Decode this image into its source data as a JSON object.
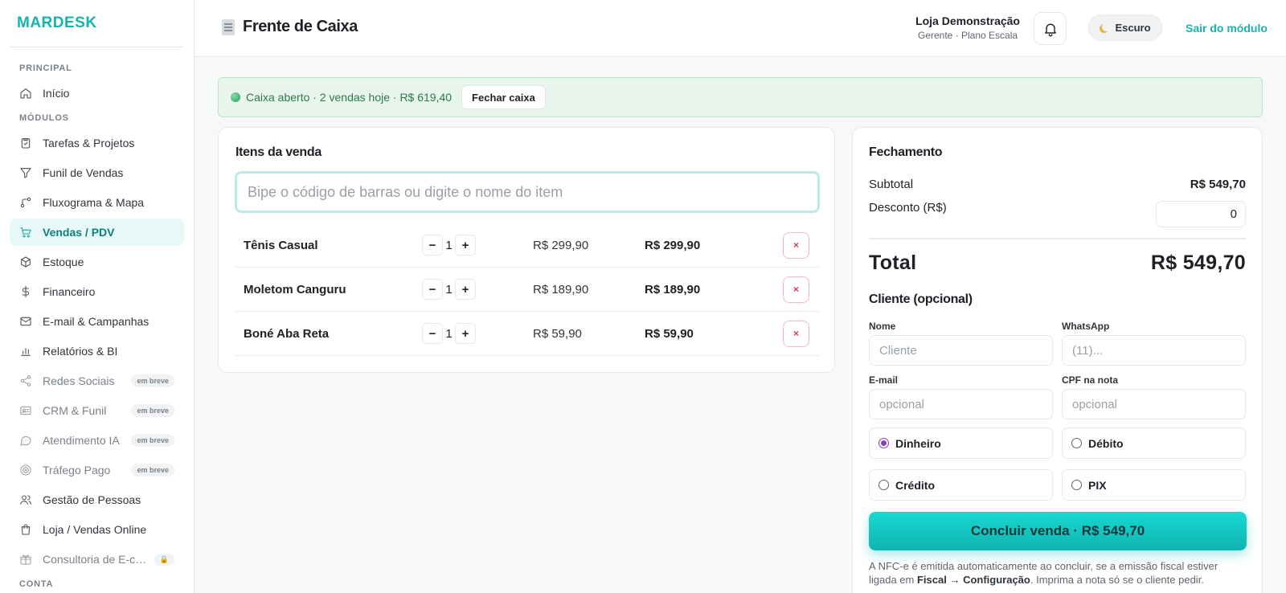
{
  "brand": {
    "name": "MARDESK"
  },
  "sidebar": {
    "section_principal": "PRINCIPAL",
    "section_modules": "MÓDULOS",
    "section_account": "CONTA",
    "home": {
      "label": "Início",
      "icon": "home-icon"
    },
    "items": [
      {
        "label": "Tarefas & Projetos",
        "icon": "clipboard-icon"
      },
      {
        "label": "Funil de Vendas",
        "icon": "filter-icon"
      },
      {
        "label": "Fluxograma & Mapa",
        "icon": "flow-icon"
      },
      {
        "label": "Vendas / PDV",
        "icon": "cart-icon",
        "active": true
      },
      {
        "label": "Estoque",
        "icon": "box-icon"
      },
      {
        "label": "Financeiro",
        "icon": "dollar-icon"
      },
      {
        "label": "E-mail & Campanhas",
        "icon": "mail-icon"
      },
      {
        "label": "Relatórios & BI",
        "icon": "bar-chart-icon"
      },
      {
        "label": "Redes Sociais",
        "icon": "share-icon",
        "badge": "em breve"
      },
      {
        "label": "CRM & Funil",
        "icon": "id-card-icon",
        "badge": "em breve"
      },
      {
        "label": "Atendimento IA",
        "icon": "chat-icon",
        "badge": "em breve"
      },
      {
        "label": "Tráfego Pago",
        "icon": "target-icon",
        "badge": "em breve"
      },
      {
        "label": "Gestão de Pessoas",
        "icon": "users-icon"
      },
      {
        "label": "Loja / Vendas Online",
        "icon": "shopping-bag-icon"
      },
      {
        "label": "Consultoria de E-commerce",
        "icon": "gift-icon",
        "badge": "🔒"
      }
    ]
  },
  "header": {
    "title": "Frente de Caixa",
    "store_name": "Loja Demonstração",
    "store_sub": "Gerente · Plano Escala",
    "theme_label": "Escuro",
    "logout_label": "Sair do módulo"
  },
  "status": {
    "text": "Caixa aberto · 2 vendas hoje · R$ 619,40",
    "close_label": "Fechar caixa",
    "color": "#2e9c5a"
  },
  "items_card": {
    "title": "Itens da venda",
    "search_placeholder": "Bipe o código de barras ou digite o nome do item",
    "rows": [
      {
        "name": "Tênis Casual",
        "qty": "1",
        "unit": "R$ 299,90",
        "total": "R$ 299,90"
      },
      {
        "name": "Moletom Canguru",
        "qty": "1",
        "unit": "R$ 189,90",
        "total": "R$ 189,90"
      },
      {
        "name": "Boné Aba Reta",
        "qty": "1",
        "unit": "R$ 59,90",
        "total": "R$ 59,90"
      }
    ],
    "minus": "−",
    "plus": "+",
    "remove": "×"
  },
  "checkout": {
    "title": "Fechamento",
    "subtotal_label": "Subtotal",
    "subtotal_value": "R$ 549,70",
    "discount_label": "Desconto (R$)",
    "discount_value": "0",
    "total_label": "Total",
    "total_value": "R$ 549,70",
    "client_title": "Cliente (opcional)",
    "name_label": "Nome",
    "name_placeholder": "Cliente",
    "whatsapp_label": "WhatsApp",
    "whatsapp_placeholder": "(11)...",
    "email_label": "E-mail",
    "email_placeholder": "opcional",
    "cpf_label": "CPF na nota",
    "cpf_placeholder": "opcional",
    "payment_options": [
      {
        "label": "Dinheiro",
        "selected": true
      },
      {
        "label": "Débito",
        "selected": false
      },
      {
        "label": "Crédito",
        "selected": false
      },
      {
        "label": "PIX",
        "selected": false
      }
    ],
    "finish_label": "Concluir venda · R$ 549,70",
    "note_prefix": "A NFC-e é emitida automaticamente ao concluir, se a emissão fiscal estiver ligada em ",
    "note_bold": "Fiscal → Configuração",
    "note_suffix": ". Imprima a nota só se o cliente pedir."
  },
  "colors": {
    "accent": "#16b3ae",
    "danger": "#d6394c",
    "radio": "#8b3fbf"
  }
}
